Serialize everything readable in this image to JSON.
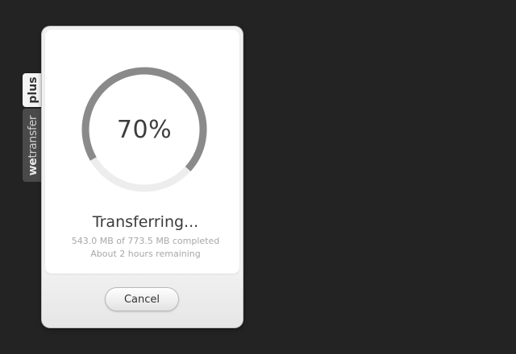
{
  "side_tabs": {
    "plus_label": "plus",
    "brand_prefix": "we",
    "brand_suffix": "transfer"
  },
  "transfer": {
    "progress_fraction": 0.7,
    "percent_label": "70%",
    "status_title": "Transferring...",
    "size_detail": "543.0 MB of 773.5 MB completed",
    "time_remaining": "About 2 hours remaining"
  },
  "actions": {
    "cancel_label": "Cancel"
  },
  "colors": {
    "background": "#232323",
    "progress_fill": "#8a8a8a",
    "progress_track": "#ededed"
  }
}
